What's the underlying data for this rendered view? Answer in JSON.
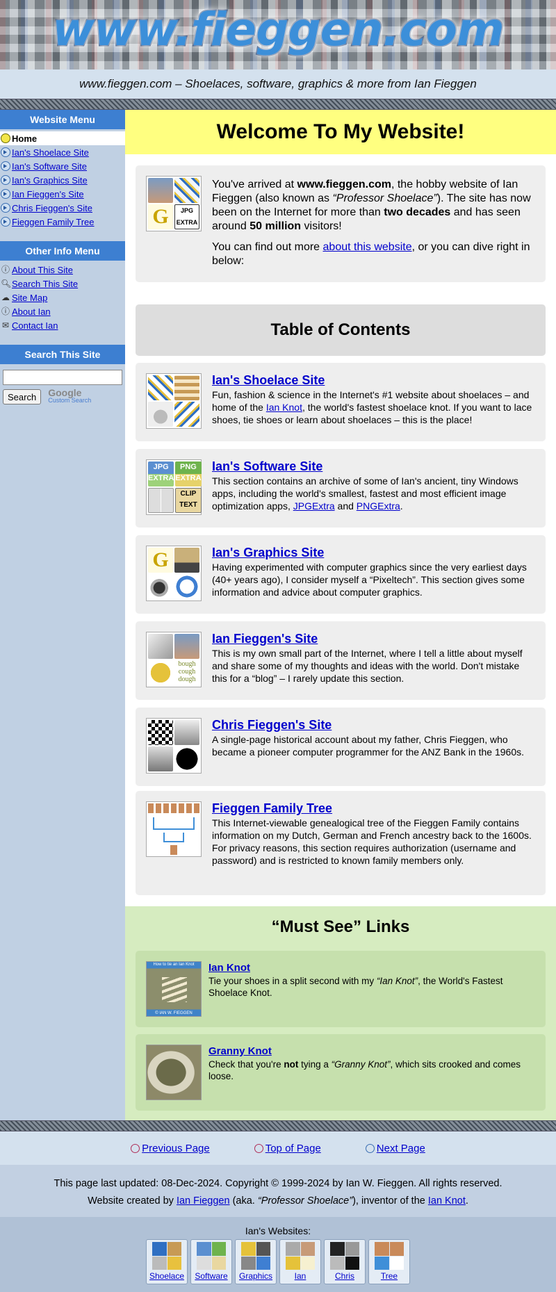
{
  "header": {
    "logo_text": "www.fieggen.com",
    "tagline": "www.fieggen.com – Shoelaces, software, graphics & more from Ian Fieggen"
  },
  "sidebar": {
    "website_menu_title": "Website Menu",
    "website_menu": [
      {
        "label": "Home",
        "icon": "yellow-dot-icon",
        "current": true
      },
      {
        "label": "Ian's Shoelace Site",
        "icon": "arrow-circle-icon"
      },
      {
        "label": "Ian's Software Site",
        "icon": "arrow-circle-icon"
      },
      {
        "label": "Ian's Graphics Site",
        "icon": "arrow-circle-icon"
      },
      {
        "label": "Ian Fieggen's Site",
        "icon": "arrow-circle-icon"
      },
      {
        "label": "Chris Fieggen's Site",
        "icon": "arrow-circle-icon"
      },
      {
        "label": "Fieggen Family Tree",
        "icon": "arrow-circle-icon"
      }
    ],
    "other_menu_title": "Other Info Menu",
    "other_menu": [
      {
        "label": "About This Site",
        "icon": "info-icon"
      },
      {
        "label": "Search This Site",
        "icon": "magnifier-icon"
      },
      {
        "label": "Site Map",
        "icon": "map-icon"
      },
      {
        "label": "About Ian",
        "icon": "info-icon"
      },
      {
        "label": "Contact Ian",
        "icon": "envelope-icon"
      }
    ],
    "search_title": "Search This Site",
    "search_value": "",
    "search_button": "Search",
    "google_label": "Google",
    "custom_search_label": "Custom Search"
  },
  "main": {
    "welcome_title": "Welcome To My Website!",
    "intro": {
      "p1_a": "You've arrived at ",
      "p1_site": "www.fieggen.com",
      "p1_b": ", the hobby website of Ian Fieggen (also known as ",
      "p1_nick": "“Professor Shoelace”",
      "p1_c": "). The site has now been on the Internet for more than ",
      "p1_decades": "two decades",
      "p1_d": " and has seen around ",
      "p1_visitors": "50 million",
      "p1_e": " visitors!",
      "p2_a": "You can find out more ",
      "p2_link": "about this website",
      "p2_b": ", or you can dive right in below:"
    },
    "toc_title": "Table of Contents",
    "sections": [
      {
        "title": "Ian's Shoelace Site",
        "text_a": "Fun, fashion & science in the Internet's #1 website about shoelaces – and home of the ",
        "link1": "Ian Knot",
        "text_b": ", the world's fastest shoelace knot. If you want to lace shoes, tie shoes or learn about shoelaces – this is the place!"
      },
      {
        "title": "Ian's Software Site",
        "text_a": "This section contains an archive of some of Ian's ancient, tiny Windows apps, including the world's smallest, fastest and most efficient image optimization apps, ",
        "link1": "JPGExtra",
        "text_mid": " and ",
        "link2": "PNGExtra",
        "text_b": "."
      },
      {
        "title": "Ian's Graphics Site",
        "text_a": "Having experimented with computer graphics since the very earliest days (40+ years ago), I consider myself a “Pixeltech”. This section gives some information and advice about computer graphics."
      },
      {
        "title": "Ian Fieggen's Site",
        "text_a": "This is my own small part of the Internet, where I tell a little about myself and share some of my thoughts and ideas with the world. Don't mistake this for a “blog” – I rarely update this section."
      },
      {
        "title": "Chris Fieggen's Site",
        "text_a": "A single-page historical account about my father, Chris Fieggen, who became a pioneer computer programmer for the ANZ Bank in the 1960s."
      },
      {
        "title": "Fieggen Family Tree",
        "text_a": "This Internet-viewable genealogical tree of the Fieggen Family contains information on my Dutch, German and French ancestry back to the 1600s. For privacy reasons, this section requires authorization (username and password) and is restricted to known family members only."
      }
    ],
    "must_see_title": "“Must See” Links",
    "must_see": [
      {
        "title": "Ian Knot",
        "thumb_caption_top": "How to tie an Ian Knot",
        "thumb_caption_bottom": "© IAN W. FIEGGEN",
        "text_a": "Tie your shoes in a split second with my ",
        "text_em": "“Ian Knot”",
        "text_b": ", the World's Fastest Shoelace Knot."
      },
      {
        "title": "Granny Knot",
        "text_a": "Check that you're ",
        "text_strong": "not",
        "text_b": " tying a ",
        "text_em": "“Granny Knot”",
        "text_c": ", which sits crooked and comes loose."
      }
    ]
  },
  "footer": {
    "nav": {
      "prev": "Previous Page",
      "top": "Top of Page",
      "next": "Next Page"
    },
    "updated": "This page last updated: 08-Dec-2024. Copyright © 1999-2024 by Ian W. Fieggen. All rights reserved.",
    "created_a": "Website created by ",
    "created_link": "Ian Fieggen",
    "created_b": " (aka. ",
    "created_em": "“Professor Shoelace”",
    "created_c": "), inventor of the ",
    "created_link2": "Ian Knot",
    "created_d": ".",
    "sites_label": "Ian's Websites:",
    "sites": [
      "Shoelace",
      "Software",
      "Graphics",
      "Ian",
      "Chris",
      "Tree"
    ]
  },
  "colors": {
    "menu_header_blue": "#3d7fd1",
    "sidebar_bg": "#c0d0e3",
    "welcome_yellow": "#ffff80",
    "must_see_green": "#d6ecc0",
    "link_blue": "#0000cc"
  }
}
